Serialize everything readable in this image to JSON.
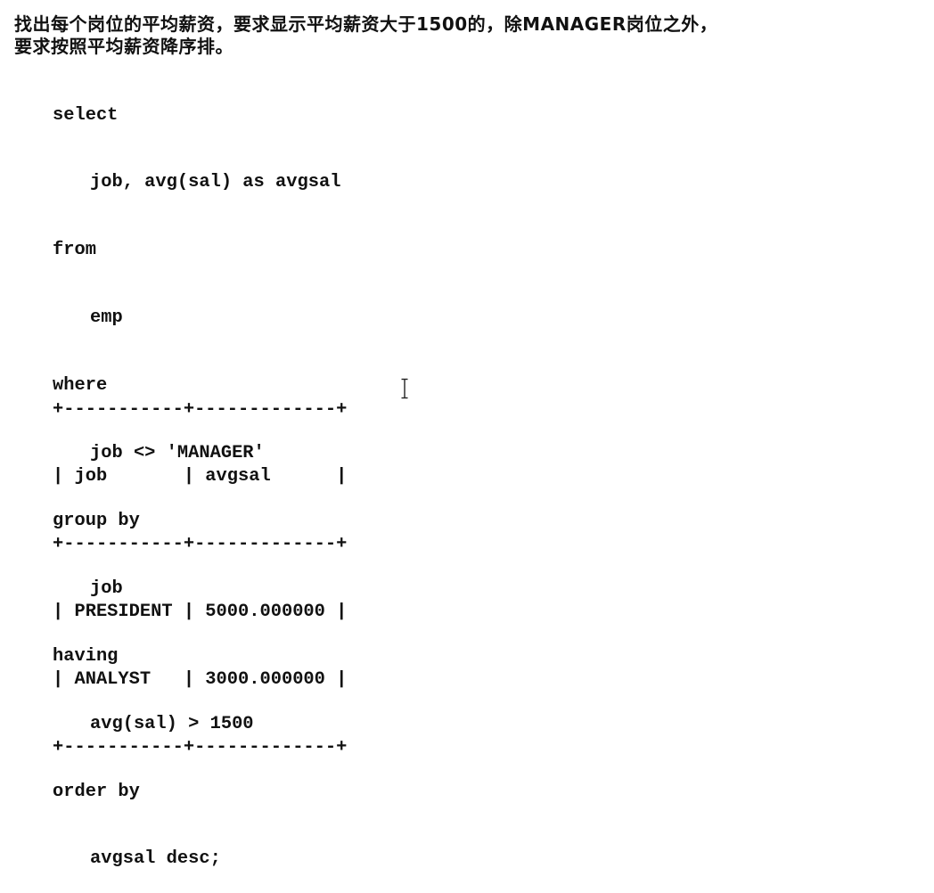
{
  "instruction": {
    "line1": "找出每个岗位的平均薪资，要求显示平均薪资大于1500的，除MANAGER岗位之外，",
    "line2": "要求按照平均薪资降序排。"
  },
  "sql": {
    "select_kw": "select",
    "select_cols": "job, avg(sal) as avgsal",
    "from_kw": "from",
    "table": "emp",
    "where_kw": "where",
    "where_cond": "job <> 'MANAGER'",
    "group_kw": "group by",
    "group_col": "job",
    "having_kw": "having",
    "having_cond": "avg(sal) > 1500",
    "order_kw": "order by",
    "order_col": "avgsal desc;"
  },
  "result_table": {
    "border": "+-----------+-------------+",
    "header": "| job       | avgsal      |",
    "rows": [
      "| PRESIDENT | 5000.000000 |",
      "| ANALYST   | 3000.000000 |"
    ]
  },
  "cursor_icon": "text-cursor-ibeam"
}
